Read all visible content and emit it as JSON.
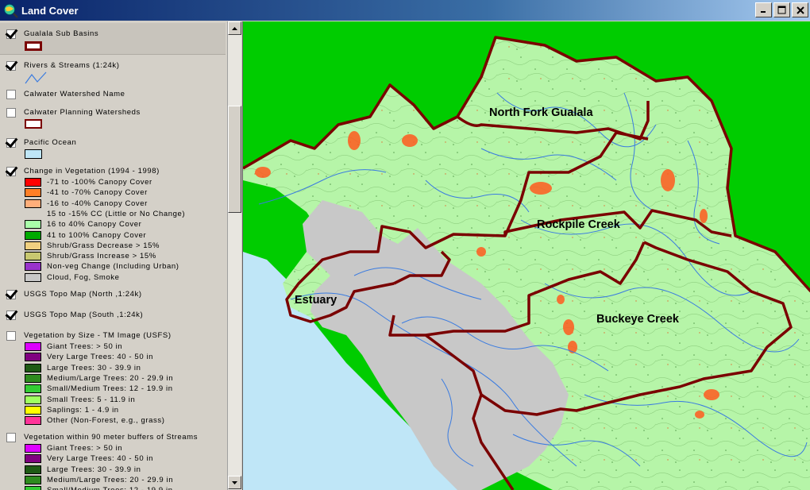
{
  "window": {
    "title": "Land Cover",
    "icon": "arcview-globe-icon",
    "buttons": [
      "minimize",
      "maximize",
      "close"
    ]
  },
  "toc": {
    "layers": [
      {
        "name": "Gualala Sub Basins",
        "checked": true
      },
      {
        "name": "Rivers & Streams (1:24k)",
        "checked": true
      },
      {
        "name": "Calwater Watershed Name",
        "checked": false
      },
      {
        "name": "Calwater Planning Watersheds",
        "checked": false
      },
      {
        "name": "Pacific Ocean",
        "checked": true
      },
      {
        "name": "Change in Vegetation (1994 - 1998)",
        "checked": true,
        "legend": [
          {
            "label": "-71 to -100% Canopy Cover",
            "color": "#ff0000"
          },
          {
            "label": "-41 to -70% Canopy Cover",
            "color": "#ff7f27"
          },
          {
            "label": "-16 to -40% Canopy Cover",
            "color": "#ffae7a"
          },
          {
            "label": "15 to -15% CC (Little or No Change)",
            "color": ""
          },
          {
            "label": "16 to 40% Canopy Cover",
            "color": "#aaffaa"
          },
          {
            "label": "41 to 100% Canopy Cover",
            "color": "#00aa00"
          },
          {
            "label": "Shrub/Grass Decrease > 15%",
            "color": "#f0d080"
          },
          {
            "label": "Shrub/Grass Increase > 15%",
            "color": "#c8c870"
          },
          {
            "label": "Non-veg Change (Including Urban)",
            "color": "#9933cc"
          },
          {
            "label": "Cloud, Fog, Smoke",
            "color": "#c8c8c8"
          }
        ]
      },
      {
        "name": "USGS Topo Map (North ,1:24k)",
        "checked": true
      },
      {
        "name": "USGS Topo Map (South ,1:24k)",
        "checked": true
      },
      {
        "name": "Vegetation by Size - TM Image (USFS)",
        "checked": false,
        "legend": [
          {
            "label": "Giant Trees: > 50 in",
            "color": "#dd00ff"
          },
          {
            "label": "Very Large Trees: 40 - 50 in",
            "color": "#800080"
          },
          {
            "label": "Large Trees: 30 - 39.9 in",
            "color": "#1e5a14"
          },
          {
            "label": "Medium/Large Trees: 20 - 29.9 in",
            "color": "#2e8b1e"
          },
          {
            "label": "Small/Medium Trees: 12 - 19.9 in",
            "color": "#33cc33"
          },
          {
            "label": "Small Trees: 5 - 11.9 in",
            "color": "#a0ff60"
          },
          {
            "label": "Saplings: 1 - 4.9 in",
            "color": "#ffff00"
          },
          {
            "label": "Other (Non-Forest, e.g., grass)",
            "color": "#ff3399"
          }
        ]
      },
      {
        "name": "Vegetation within 90 meter buffers of Streams",
        "checked": false,
        "legend": [
          {
            "label": "Giant Trees: > 50 in",
            "color": "#dd00ff"
          },
          {
            "label": "Very Large Trees: 40 - 50 in",
            "color": "#800080"
          },
          {
            "label": "Large Trees: 30 - 39.9 in",
            "color": "#1e5a14"
          },
          {
            "label": "Medium/Large Trees: 20 - 29.9 in",
            "color": "#2e8b1e"
          },
          {
            "label": "Small/Medium Trees: 12 - 19.9 in",
            "color": "#33cc33"
          }
        ]
      }
    ]
  },
  "map": {
    "labels": {
      "north_fork": "North Fork Gualala",
      "rockpile": "Rockpile Creek",
      "buckeye": "Buckeye Creek",
      "estuary": "Estuary"
    },
    "colors": {
      "ocean": "#bfe6f7",
      "land_outside": "#00cc00",
      "basin_border": "#7a0000",
      "streams": "#3a7be0",
      "cloud": "#c8c8c8",
      "vegetation": "#aaffaa"
    }
  }
}
